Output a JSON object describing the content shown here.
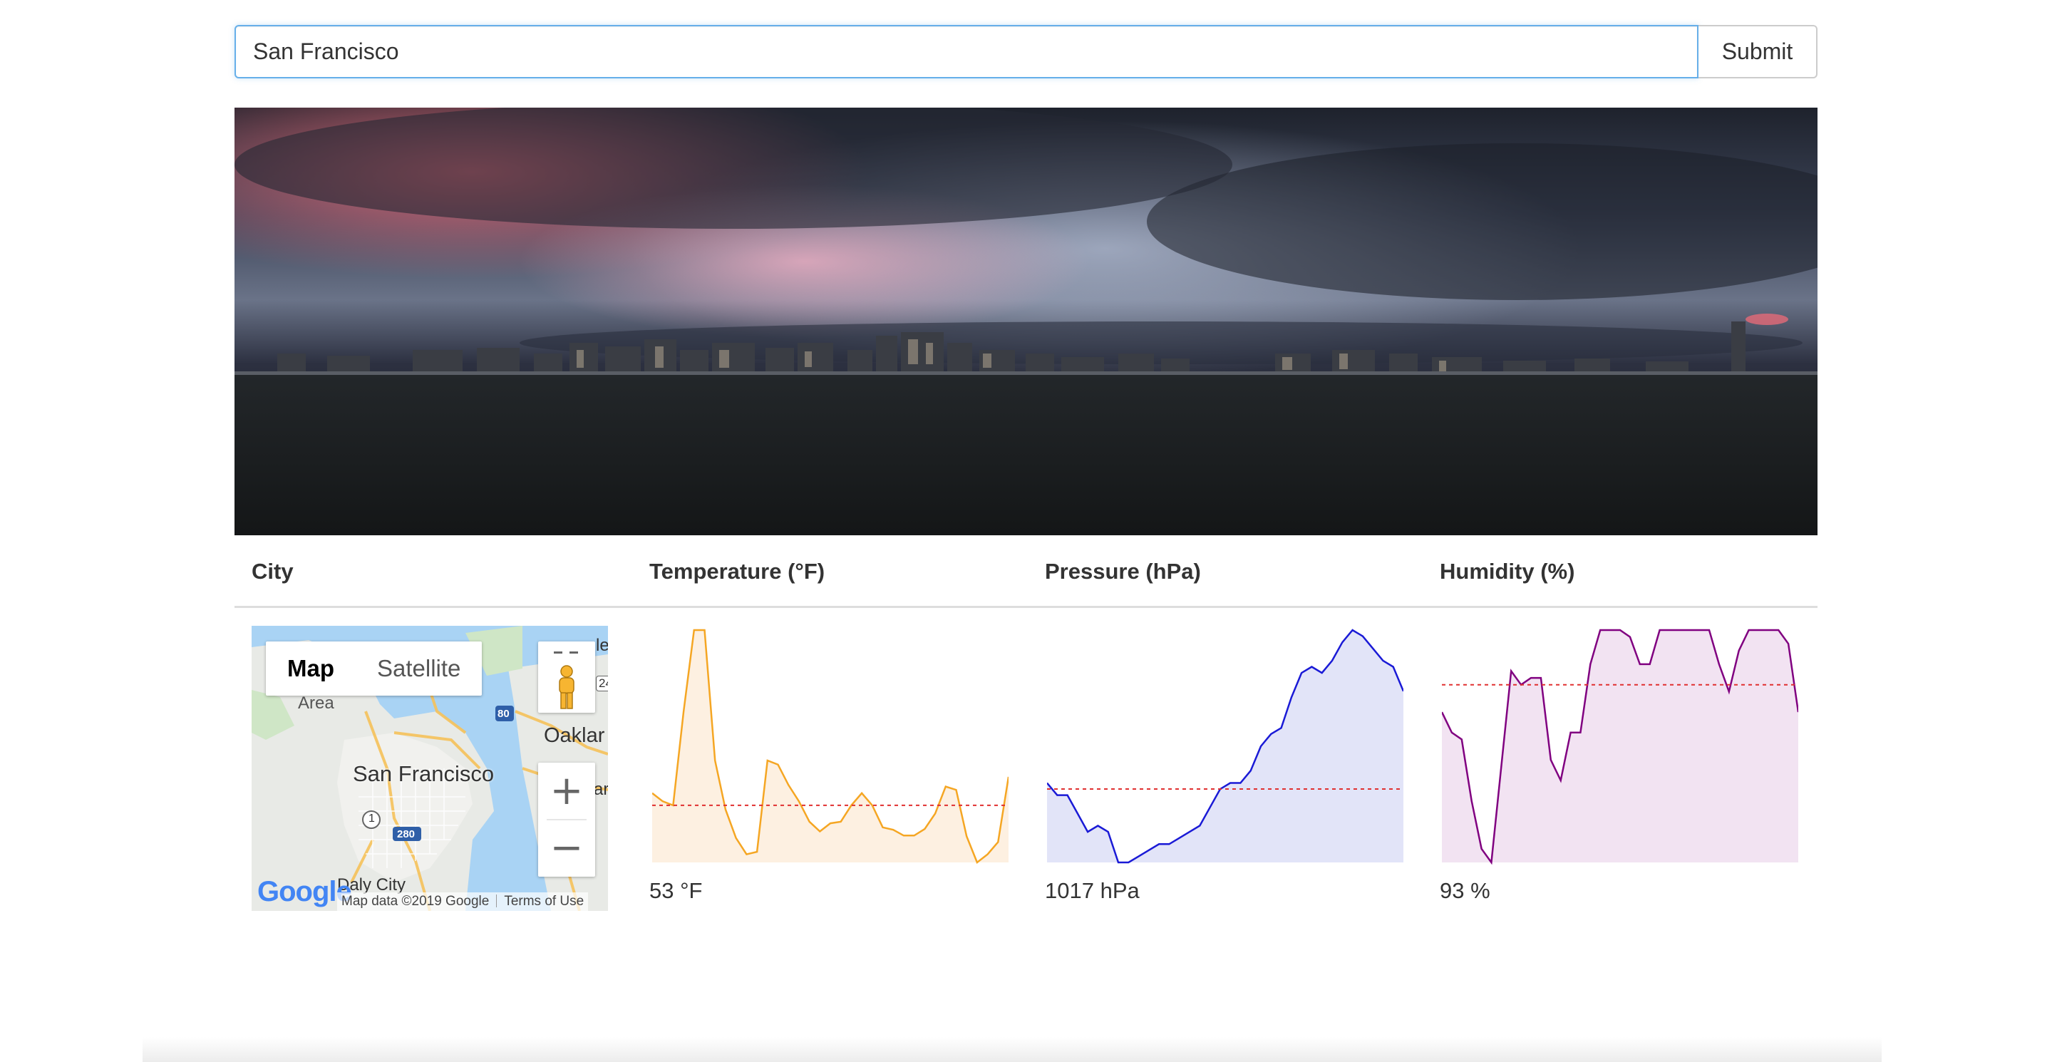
{
  "search": {
    "value": "San Francisco",
    "submit_label": "Submit"
  },
  "table": {
    "headers": [
      "City",
      "Temperature (°F)",
      "Pressure (hPa)",
      "Humidity (%)"
    ]
  },
  "map": {
    "toggle": {
      "map_label": "Map",
      "satellite_label": "Satellite"
    },
    "labels": {
      "city": "San Francisco",
      "area": "Area",
      "oakland": "Oaklar",
      "daly_city": "Daly City",
      "edge_top": "le",
      "edge_mid": "ar",
      "route_24": "24",
      "route_80": "80",
      "route_1": "1",
      "route_280": "280"
    },
    "zoom_in": "+",
    "zoom_out": "−",
    "attribution": "Map data ©2019 Google",
    "terms": "Terms of Use",
    "logo": "Google"
  },
  "readings": {
    "temperature": "53 °F",
    "pressure": "1017 hPa",
    "humidity": "93 %"
  },
  "chart_data": [
    {
      "type": "area",
      "series": [
        {
          "values": [
            56,
            55,
            54.5,
            66,
            76,
            76,
            60,
            54,
            50.5,
            48.5,
            48.8,
            60,
            59.5,
            57,
            55,
            52.5,
            51.3,
            52.3,
            52.5,
            54.5,
            56,
            54.5,
            51.8,
            51.5,
            50.8,
            50.8,
            51.6,
            53.5,
            56.8,
            56.4,
            50.7,
            47.5,
            48.5,
            50,
            58
          ]
        }
      ],
      "mean": 54.5,
      "colors": {
        "line": "#f5a623",
        "fill": "#fdf0e1",
        "mean": "#e03030"
      }
    },
    {
      "type": "area",
      "series": [
        {
          "values": [
            1015,
            1014,
            1014,
            1012.5,
            1011,
            1011.5,
            1011,
            1008.5,
            1008.5,
            1009,
            1009.5,
            1010,
            1010,
            1010.5,
            1011,
            1011.5,
            1013,
            1014.5,
            1015,
            1015,
            1016,
            1018,
            1019,
            1019.5,
            1022,
            1024,
            1024.5,
            1024,
            1025,
            1026.5,
            1027.5,
            1027,
            1026,
            1025,
            1024.5,
            1022.5
          ]
        }
      ],
      "mean": 1014.5,
      "colors": {
        "line": "#1a1ad6",
        "fill": "#e2e4f8",
        "mean": "#e03030"
      }
    },
    {
      "type": "area",
      "series": [
        {
          "values": [
            88,
            85,
            84,
            75,
            68,
            66,
            80,
            94,
            92,
            93,
            93,
            81,
            78,
            85,
            85,
            95,
            100,
            100,
            100,
            99,
            95,
            95,
            100,
            100,
            100,
            100,
            100,
            100,
            95,
            91,
            97,
            100,
            100,
            100,
            100,
            98,
            88
          ]
        }
      ],
      "mean": 92,
      "colors": {
        "line": "#800080",
        "fill": "#f2e3f2",
        "mean": "#e03030"
      }
    }
  ]
}
